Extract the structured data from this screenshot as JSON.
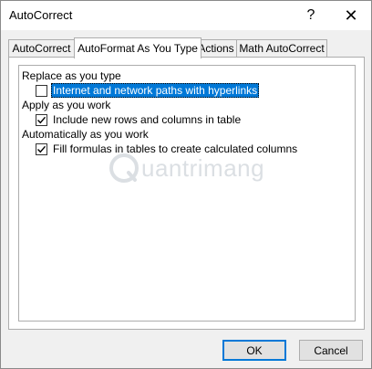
{
  "window": {
    "title": "AutoCorrect",
    "help_glyph": "?",
    "close_glyph": "✕"
  },
  "tabs": [
    {
      "label": "AutoCorrect",
      "active": false
    },
    {
      "label": "AutoFormat As You Type",
      "active": true
    },
    {
      "label": "Actions",
      "active": false
    },
    {
      "label": "Math AutoCorrect",
      "active": false
    }
  ],
  "groups": {
    "replace": {
      "label": "Replace as you type",
      "options": [
        {
          "label": "Internet and network paths with hyperlinks",
          "checked": false,
          "selected": true
        }
      ]
    },
    "apply": {
      "label": "Apply as you work",
      "options": [
        {
          "label": "Include new rows and columns in table",
          "checked": true,
          "selected": false
        }
      ]
    },
    "auto": {
      "label": "Automatically as you work",
      "options": [
        {
          "label": "Fill formulas in tables to create calculated columns",
          "checked": true,
          "selected": false
        }
      ]
    }
  },
  "watermark": {
    "text": "uantrimang"
  },
  "buttons": {
    "ok": "OK",
    "cancel": "Cancel"
  },
  "colors": {
    "selection": "#0078d7",
    "default_button_border": "#0078d7"
  }
}
